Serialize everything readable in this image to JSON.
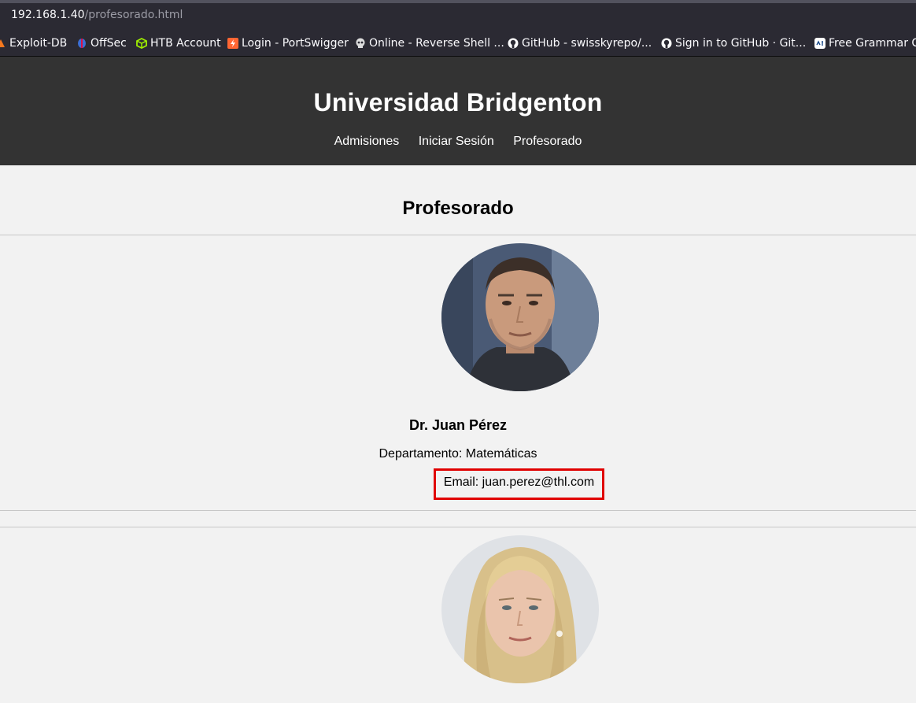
{
  "browser": {
    "url_host": "192.168.1.40",
    "url_path": "/profesorado.html",
    "bookmarks": [
      {
        "label": "Exploit-DB",
        "icon": "exploitdb-icon"
      },
      {
        "label": "OffSec",
        "icon": "offsec-icon"
      },
      {
        "label": "HTB Account",
        "icon": "htb-icon"
      },
      {
        "label": "Login - PortSwigger",
        "icon": "portswigger-icon"
      },
      {
        "label": "Online - Reverse Shell ...",
        "icon": "skull-icon"
      },
      {
        "label": "GitHub - swisskyrepo/...",
        "icon": "github-icon"
      },
      {
        "label": "Sign in to GitHub · Git...",
        "icon": "github-icon"
      },
      {
        "label": "Free Grammar Ch",
        "icon": "languagetool-icon"
      }
    ]
  },
  "site": {
    "title": "Universidad Bridgenton",
    "nav": [
      "Admisiones",
      "Iniciar Sesión",
      "Profesorado"
    ]
  },
  "page": {
    "heading": "Profesorado",
    "professors": [
      {
        "name": "Dr. Juan Pérez",
        "department": "Departamento: Matemáticas",
        "email": "Email: juan.perez@thl.com"
      }
    ]
  },
  "colors": {
    "header_bg": "#333333",
    "page_bg": "#f2f2f2",
    "highlight_box": "#e00000",
    "browser_chrome": "#2b2a33"
  }
}
